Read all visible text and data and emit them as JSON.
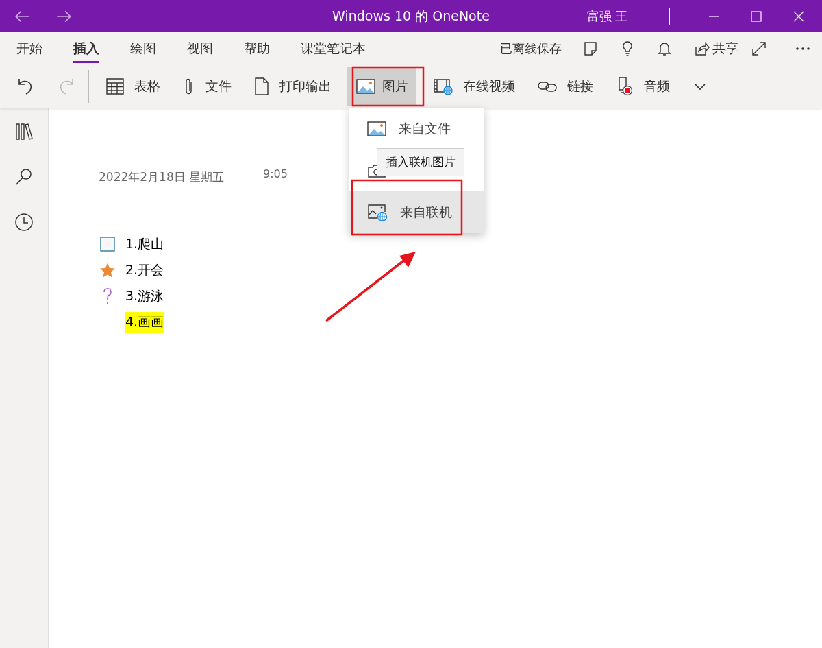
{
  "window": {
    "title": "Windows 10 的 OneNote",
    "user": "富强 王"
  },
  "tabs": [
    {
      "label": "开始",
      "selected": false
    },
    {
      "label": "插入",
      "selected": true
    },
    {
      "label": "绘图",
      "selected": false
    },
    {
      "label": "视图",
      "selected": false
    },
    {
      "label": "帮助",
      "selected": false
    },
    {
      "label": "课堂笔记本",
      "selected": false
    }
  ],
  "header_actions": {
    "sync_status": "已离线保存",
    "share": "共享"
  },
  "toolbar": [
    {
      "kind": "undo",
      "disabled": false,
      "expanded": false
    },
    {
      "kind": "redo",
      "disabled": true,
      "expanded": false
    },
    {
      "kind": "table",
      "label": "表格",
      "disabled": false,
      "expanded": false
    },
    {
      "kind": "file",
      "label": "文件",
      "disabled": false,
      "expanded": false
    },
    {
      "kind": "printout",
      "label": "打印输出",
      "disabled": false,
      "expanded": false
    },
    {
      "kind": "picture",
      "label": "图片",
      "disabled": false,
      "expanded": true
    },
    {
      "kind": "video",
      "label": "在线视频",
      "disabled": false,
      "expanded": false
    },
    {
      "kind": "link",
      "label": "链接",
      "disabled": false,
      "expanded": false
    },
    {
      "kind": "audio",
      "label": "音频",
      "disabled": false,
      "expanded": false
    },
    {
      "kind": "more",
      "disabled": false,
      "expanded": false
    }
  ],
  "picture_menu": {
    "items": [
      {
        "kind": "file",
        "label": "来自文件",
        "selected": false
      },
      {
        "kind": "camera",
        "selected": false
      },
      {
        "kind": "online",
        "label": "来自联机",
        "selected": true
      }
    ],
    "tooltip": "插入联机图片"
  },
  "page": {
    "date": "2022年2月18日 星期五",
    "time": "9:05",
    "notes": [
      {
        "kind": "checkbox",
        "text": "1.爬山",
        "highlighted": false
      },
      {
        "kind": "star",
        "text": "2.开会",
        "highlighted": false
      },
      {
        "kind": "question",
        "text": "3.游泳",
        "highlighted": false
      },
      {
        "kind": "plain",
        "text": "4.画画",
        "highlighted": true
      }
    ]
  }
}
